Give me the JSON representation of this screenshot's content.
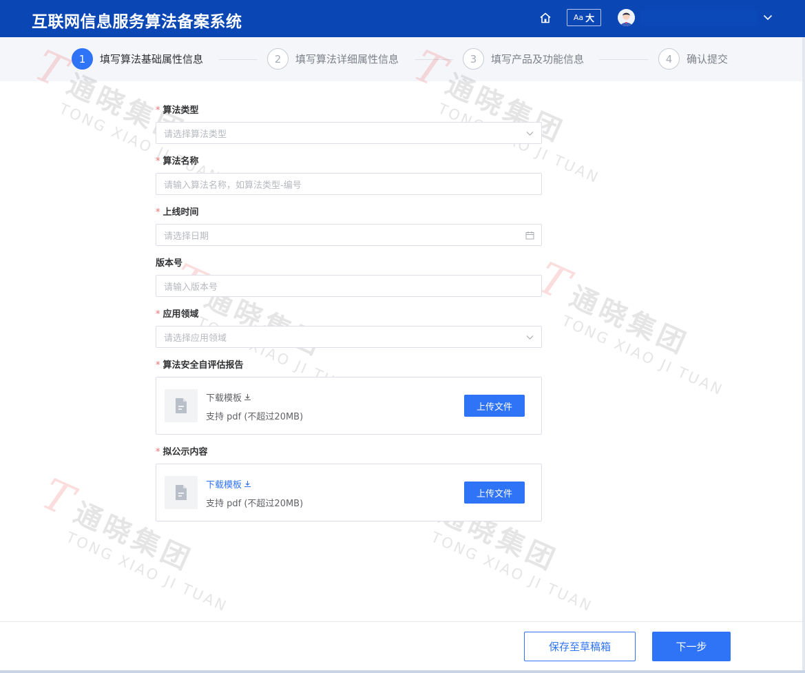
{
  "header": {
    "title": "互联网信息服务算法备案系统",
    "font_toggle_small": "Aa",
    "font_toggle_big": "大",
    "icons": [
      "home-icon",
      "user-avatar",
      "chevron-down-icon"
    ]
  },
  "steps": [
    {
      "num": "1",
      "label": "填写算法基础属性信息",
      "active": true
    },
    {
      "num": "2",
      "label": "填写算法详细属性信息",
      "active": false
    },
    {
      "num": "3",
      "label": "填写产品及功能信息",
      "active": false
    },
    {
      "num": "4",
      "label": "确认提交",
      "active": false
    }
  ],
  "watermark": {
    "logo": "T",
    "cn": "通晓集团",
    "en": "TONG XIAO JI TUAN"
  },
  "form": {
    "required_mark": "*",
    "algo_type": {
      "label": "算法类型",
      "placeholder": "请选择算法类型",
      "icon": "chevron-down-icon"
    },
    "algo_name": {
      "label": "算法名称",
      "placeholder": "请输入算法名称，如算法类型-编号"
    },
    "launch_date": {
      "label": "上线时间",
      "placeholder": "请选择日期",
      "icon": "calendar-icon"
    },
    "version": {
      "label": "版本号",
      "placeholder": "请输入版本号"
    },
    "domain": {
      "label": "应用领域",
      "placeholder": "请选择应用领域",
      "icon": "chevron-down-icon"
    },
    "security_report": {
      "label": "算法安全自评估报告",
      "template_link": "下载模板",
      "hint": "支持 pdf (不超过20MB)",
      "upload_label": "上传文件"
    },
    "public_content": {
      "label": "拟公示内容",
      "template_link": "下载模板",
      "hint": "支持 pdf (不超过20MB)",
      "upload_label": "上传文件"
    }
  },
  "footer": {
    "save_draft": "保存至草稿箱",
    "next": "下一步"
  },
  "colors": {
    "header_bg": "#0a47b5",
    "primary": "#2f73f6",
    "required": "#f56c6c"
  }
}
